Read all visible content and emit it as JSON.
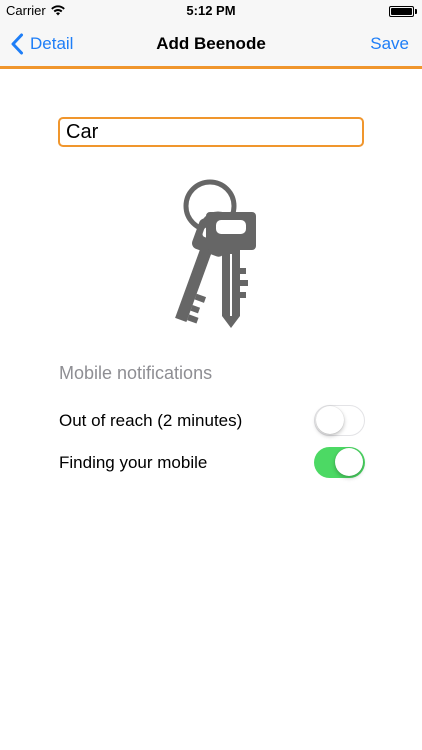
{
  "status_bar": {
    "carrier": "Carrier",
    "time": "5:12 PM",
    "wifi_icon": "wifi-icon",
    "battery_icon": "battery-icon",
    "battery_level": 1.0
  },
  "nav": {
    "back_label": "Detail",
    "title": "Add Beenode",
    "save_label": "Save",
    "back_icon": "chevron-left-icon"
  },
  "form": {
    "name_value": "Car",
    "image_icon": "keys-icon"
  },
  "notifications": {
    "section_label": "Mobile notifications",
    "items": [
      {
        "label": "Out of reach (2 minutes)",
        "enabled": false
      },
      {
        "label": "Finding your mobile",
        "enabled": true
      }
    ]
  },
  "colors": {
    "accent": "#f0962d",
    "link": "#1e7ef7",
    "toggle_on": "#4cd964",
    "icon_gray": "#666666",
    "section_gray": "#8e8e93"
  }
}
